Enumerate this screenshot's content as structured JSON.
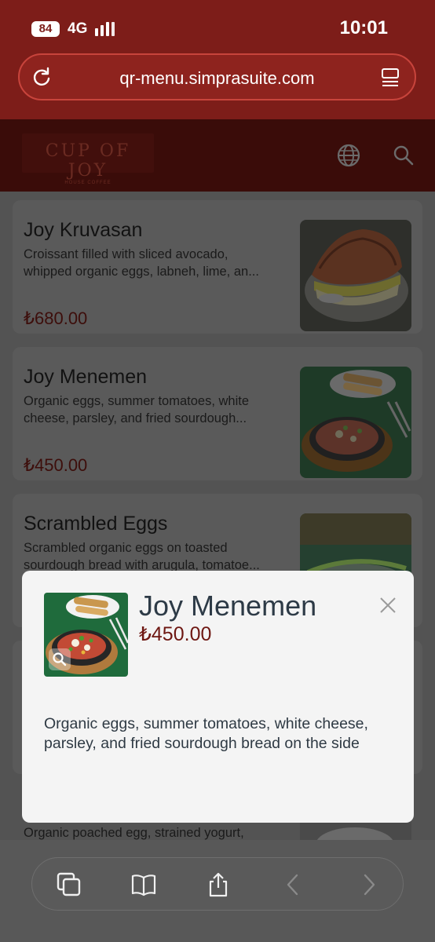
{
  "status_bar": {
    "battery": "84",
    "network": "4G",
    "time": "10:01"
  },
  "browser": {
    "url": "qr-menu.simprasuite.com"
  },
  "site": {
    "logo_text": "CUP OF JOY",
    "logo_subtext": "HOUSE COFFEE"
  },
  "menu_items": [
    {
      "title": "Joy Kruvasan",
      "desc_line1": "Croissant filled with sliced avocado,",
      "desc_line2": "whipped organic eggs, labneh, lime, an...",
      "price": "₺680.00"
    },
    {
      "title": "Joy Menemen",
      "desc_line1": "Organic eggs, summer tomatoes, white",
      "desc_line2": "cheese, parsley, and fried sourdough...",
      "price": "₺450.00"
    },
    {
      "title": "Scrambled Eggs",
      "desc_line1": "Scrambled organic eggs on toasted",
      "desc_line2": "sourdough bread with arugula, tomatoe...",
      "price": ""
    },
    {
      "title": "",
      "desc_line1": "Organic poached egg, strained yogurt,",
      "desc_line2": "",
      "price": ""
    }
  ],
  "modal": {
    "title": "Joy Menemen",
    "price": "₺450.00",
    "description": "Organic eggs, summer tomatoes, white cheese, parsley, and fried sourdough bread on the side"
  },
  "colors": {
    "brand_red": "#7d1d19",
    "price_red": "#6e1712",
    "overlay_gray": "#535353"
  }
}
